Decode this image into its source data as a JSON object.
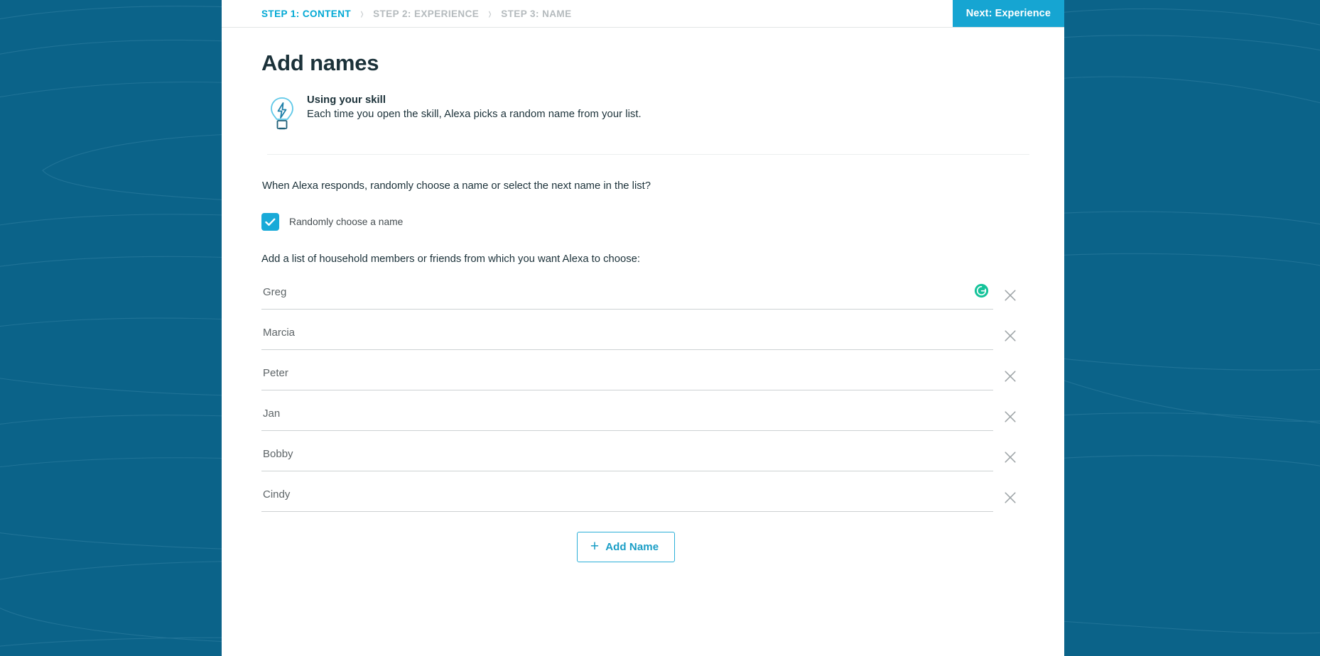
{
  "colors": {
    "backdrop": "#0b6389",
    "accent_cyan": "#00a8d4",
    "button_blue": "#16a5d2",
    "checkbox_blue": "#19aad8",
    "grammarly_green": "#15c39a",
    "text_dark": "#1b3139",
    "text_muted": "#b4babd"
  },
  "stepbar": {
    "steps": [
      {
        "label": "STEP 1: CONTENT",
        "state": "active"
      },
      {
        "label": "STEP 2: EXPERIENCE",
        "state": "inactive"
      },
      {
        "label": "STEP 3: NAME",
        "state": "inactive"
      }
    ],
    "chevron": "›",
    "next_button": "Next: Experience"
  },
  "main": {
    "title": "Add names",
    "tip": {
      "icon": "lightbulb-icon",
      "heading": "Using your skill",
      "text": "Each time you open the skill, Alexa picks a random name from your list."
    },
    "question": "When Alexa responds, randomly choose a name or select the next name in the list?",
    "checkbox": {
      "label": "Randomly choose a name",
      "checked": true
    },
    "list_prompt": "Add a list of household members or friends from which you want Alexa to choose:",
    "names": [
      {
        "value": "Greg",
        "placeholder": "Name",
        "grammarly": true
      },
      {
        "value": "Marcia",
        "placeholder": "Name",
        "grammarly": false
      },
      {
        "value": "Peter",
        "placeholder": "Name",
        "grammarly": false
      },
      {
        "value": "Jan",
        "placeholder": "Name",
        "grammarly": false
      },
      {
        "value": "Bobby",
        "placeholder": "Name",
        "grammarly": false
      },
      {
        "value": "Cindy",
        "placeholder": "Name",
        "grammarly": false
      }
    ],
    "add_name_button": {
      "plus": "+",
      "label": "Add Name"
    }
  }
}
